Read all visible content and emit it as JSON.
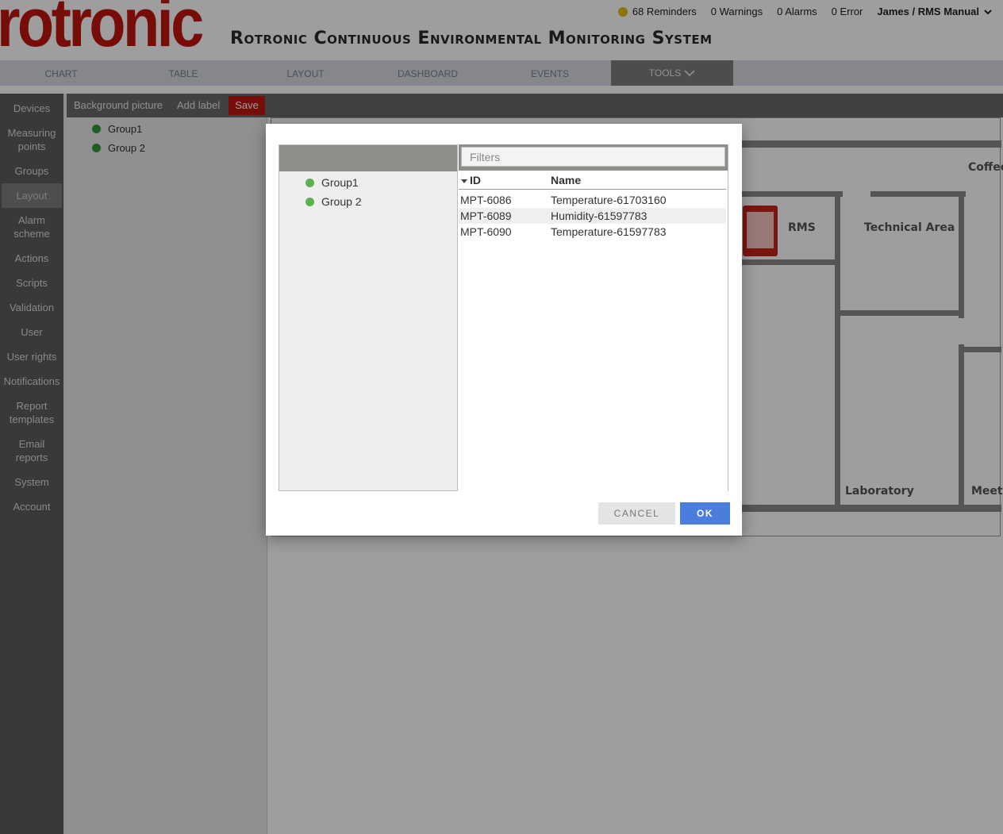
{
  "header": {
    "logo_text": "rotronic",
    "app_title": "Rotronic Continuous Environmental Monitoring System",
    "reminders": "68 Reminders",
    "warnings": "0 Warnings",
    "alarms": "0 Alarms",
    "errors": "0 Error",
    "user": "James / RMS Manual",
    "reminder_color": "#e3bf12"
  },
  "topnav": {
    "tabs": [
      "CHART",
      "TABLE",
      "LAYOUT",
      "DASHBOARD",
      "EVENTS",
      "TOOLS"
    ],
    "active": "TOOLS"
  },
  "sidebar": {
    "items": [
      "Devices",
      "Measuring points",
      "Groups",
      "Layout",
      "Alarm scheme",
      "Actions",
      "Scripts",
      "Validation",
      "User",
      "User rights",
      "Notifications",
      "Report templates",
      "Email reports",
      "System",
      "Account"
    ],
    "active": "Layout"
  },
  "toolbar": {
    "background_picture": "Background picture",
    "add_label": "Add label",
    "save": "Save"
  },
  "groups": [
    "Group1",
    "Group 2"
  ],
  "floorplan": {
    "rooms": [
      "Coffee",
      "RMS",
      "Technical Area",
      "Laboratory",
      "Meeti"
    ]
  },
  "dialog": {
    "groups": [
      "Group1",
      "Group 2"
    ],
    "filter_placeholder": "Filters",
    "columns": {
      "id": "ID",
      "name": "Name"
    },
    "rows": [
      {
        "id": "MPT-6086",
        "name": "Temperature-61703160"
      },
      {
        "id": "MPT-6089",
        "name": "Humidity-61597783"
      },
      {
        "id": "MPT-6090",
        "name": "Temperature-61597783"
      }
    ],
    "cancel": "CANCEL",
    "ok": "OK"
  },
  "colors": {
    "brand_red": "#c0160f",
    "ok_blue": "#4a7ddc",
    "group_green": "#5ab153"
  }
}
